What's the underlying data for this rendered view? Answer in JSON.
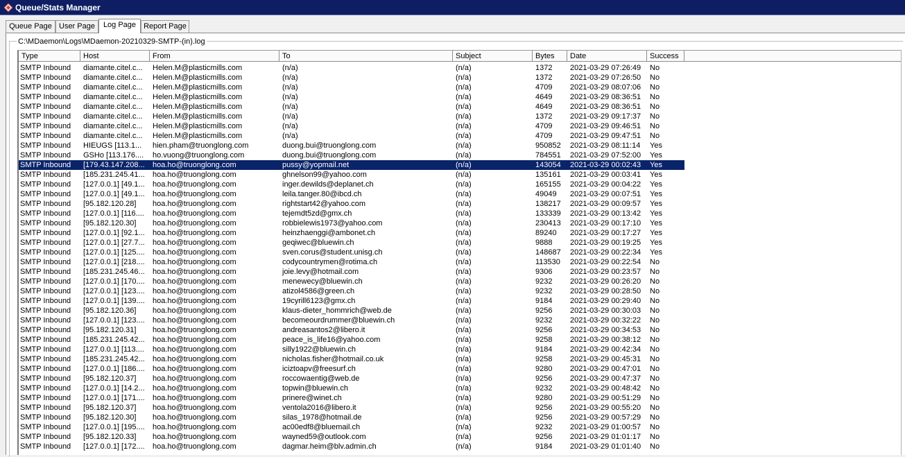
{
  "window": {
    "title": "Queue/Stats Manager"
  },
  "tabs": [
    {
      "label": "Queue Page",
      "active": false
    },
    {
      "label": "User Page",
      "active": false
    },
    {
      "label": "Log Page",
      "active": true
    },
    {
      "label": "Report Page",
      "active": false
    }
  ],
  "log_path": "C:\\MDaemon\\Logs\\MDaemon-20210329-SMTP-(in).log",
  "columns": [
    "Type",
    "Host",
    "From",
    "To",
    "Subject",
    "Bytes",
    "Date",
    "Success"
  ],
  "selected_row_index": 10,
  "rows": [
    [
      "SMTP Inbound",
      "diamante.citel.c...",
      "Helen.M@plasticmills.com",
      "(n/a)",
      "(n/a)",
      "1372",
      "2021-03-29 07:26:49",
      "No"
    ],
    [
      "SMTP Inbound",
      "diamante.citel.c...",
      "Helen.M@plasticmills.com",
      "(n/a)",
      "(n/a)",
      "1372",
      "2021-03-29 07:26:50",
      "No"
    ],
    [
      "SMTP Inbound",
      "diamante.citel.c...",
      "Helen.M@plasticmills.com",
      "(n/a)",
      "(n/a)",
      "4709",
      "2021-03-29 08:07:06",
      "No"
    ],
    [
      "SMTP Inbound",
      "diamante.citel.c...",
      "Helen.M@plasticmills.com",
      "(n/a)",
      "(n/a)",
      "4649",
      "2021-03-29 08:36:51",
      "No"
    ],
    [
      "SMTP Inbound",
      "diamante.citel.c...",
      "Helen.M@plasticmills.com",
      "(n/a)",
      "(n/a)",
      "4649",
      "2021-03-29 08:36:51",
      "No"
    ],
    [
      "SMTP Inbound",
      "diamante.citel.c...",
      "Helen.M@plasticmills.com",
      "(n/a)",
      "(n/a)",
      "1372",
      "2021-03-29 09:17:37",
      "No"
    ],
    [
      "SMTP Inbound",
      "diamante.citel.c...",
      "Helen.M@plasticmills.com",
      "(n/a)",
      "(n/a)",
      "4709",
      "2021-03-29 09:46:51",
      "No"
    ],
    [
      "SMTP Inbound",
      "diamante.citel.c...",
      "Helen.M@plasticmills.com",
      "(n/a)",
      "(n/a)",
      "4709",
      "2021-03-29 09:47:51",
      "No"
    ],
    [
      "SMTP Inbound",
      "HIEUGS [113.1...",
      "hien.pham@truonglong.com",
      "duong.bui@truonglong.com",
      "(n/a)",
      "950852",
      "2021-03-29 08:11:14",
      "Yes"
    ],
    [
      "SMTP Inbound",
      "GSHo [113.176....",
      "ho.vuong@truonglong.com",
      "duong.bui@truonglong.com",
      "(n/a)",
      "784551",
      "2021-03-29 07:52:00",
      "Yes"
    ],
    [
      "SMTP Inbound",
      "[179.43.147.208...",
      "hoa.ho@truonglong.com",
      "pussy@yopmail.net",
      "(n/a)",
      "143054",
      "2021-03-29 00:02:43",
      "Yes"
    ],
    [
      "SMTP Inbound",
      "[185.231.245.41...",
      "hoa.ho@truonglong.com",
      "ghnelson99@yahoo.com",
      "(n/a)",
      "135161",
      "2021-03-29 00:03:41",
      "Yes"
    ],
    [
      "SMTP Inbound",
      "[127.0.0.1] [49.1...",
      "hoa.ho@truonglong.com",
      "inger.dewilds@deplanet.ch",
      "(n/a)",
      "165155",
      "2021-03-29 00:04:22",
      "Yes"
    ],
    [
      "SMTP Inbound",
      "[127.0.0.1] [49.1...",
      "hoa.ho@truonglong.com",
      "leila.tanger.80@ibcd.ch",
      "(n/a)",
      "49049",
      "2021-03-29 00:07:51",
      "Yes"
    ],
    [
      "SMTP Inbound",
      "[95.182.120.28]",
      "hoa.ho@truonglong.com",
      "rightstart42@yahoo.com",
      "(n/a)",
      "138217",
      "2021-03-29 00:09:57",
      "Yes"
    ],
    [
      "SMTP Inbound",
      "[127.0.0.1] [116....",
      "hoa.ho@truonglong.com",
      "tejemdt5zd@gmx.ch",
      "(n/a)",
      "133339",
      "2021-03-29 00:13:42",
      "Yes"
    ],
    [
      "SMTP Inbound",
      "[95.182.120.30]",
      "hoa.ho@truonglong.com",
      "robbielewis1973@yahoo.com",
      "(n/a)",
      "230413",
      "2021-03-29 00:17:10",
      "Yes"
    ],
    [
      "SMTP Inbound",
      "[127.0.0.1] [92.1...",
      "hoa.ho@truonglong.com",
      "heinzhaenggi@ambonet.ch",
      "(n/a)",
      "89240",
      "2021-03-29 00:17:27",
      "Yes"
    ],
    [
      "SMTP Inbound",
      "[127.0.0.1] [27.7...",
      "hoa.ho@truonglong.com",
      "geqiwec@bluewin.ch",
      "(n/a)",
      "9888",
      "2021-03-29 00:19:25",
      "Yes"
    ],
    [
      "SMTP Inbound",
      "[127.0.0.1] [125....",
      "hoa.ho@truonglong.com",
      "sven.corus@student.unisg.ch",
      "(n/a)",
      "148687",
      "2021-03-29 00:22:34",
      "Yes"
    ],
    [
      "SMTP Inbound",
      "[127.0.0.1] [218....",
      "hoa.ho@truonglong.com",
      "codycountrymen@rotima.ch",
      "(n/a)",
      "113530",
      "2021-03-29 00:22:54",
      "No"
    ],
    [
      "SMTP Inbound",
      "[185.231.245.46...",
      "hoa.ho@truonglong.com",
      "joie.levy@hotmail.com",
      "(n/a)",
      "9306",
      "2021-03-29 00:23:57",
      "No"
    ],
    [
      "SMTP Inbound",
      "[127.0.0.1] [170....",
      "hoa.ho@truonglong.com",
      "menewecy@bluewin.ch",
      "(n/a)",
      "9232",
      "2021-03-29 00:26:20",
      "No"
    ],
    [
      "SMTP Inbound",
      "[127.0.0.1] [123....",
      "hoa.ho@truonglong.com",
      "atizol4586@green.ch",
      "(n/a)",
      "9232",
      "2021-03-29 00:28:50",
      "No"
    ],
    [
      "SMTP Inbound",
      "[127.0.0.1] [139....",
      "hoa.ho@truonglong.com",
      "19cyrill6123@gmx.ch",
      "(n/a)",
      "9184",
      "2021-03-29 00:29:40",
      "No"
    ],
    [
      "SMTP Inbound",
      "[95.182.120.36]",
      "hoa.ho@truonglong.com",
      "klaus-dieter_hommrich@web.de",
      "(n/a)",
      "9256",
      "2021-03-29 00:30:03",
      "No"
    ],
    [
      "SMTP Inbound",
      "[127.0.0.1] [123....",
      "hoa.ho@truonglong.com",
      "becomeourdrummer@bluewin.ch",
      "(n/a)",
      "9232",
      "2021-03-29 00:32:22",
      "No"
    ],
    [
      "SMTP Inbound",
      "[95.182.120.31]",
      "hoa.ho@truonglong.com",
      "andreasantos2@libero.it",
      "(n/a)",
      "9256",
      "2021-03-29 00:34:53",
      "No"
    ],
    [
      "SMTP Inbound",
      "[185.231.245.42...",
      "hoa.ho@truonglong.com",
      "peace_is_life16@yahoo.com",
      "(n/a)",
      "9258",
      "2021-03-29 00:38:12",
      "No"
    ],
    [
      "SMTP Inbound",
      "[127.0.0.1] [113....",
      "hoa.ho@truonglong.com",
      "silly1922@bluewin.ch",
      "(n/a)",
      "9184",
      "2021-03-29 00:42:34",
      "No"
    ],
    [
      "SMTP Inbound",
      "[185.231.245.42...",
      "hoa.ho@truonglong.com",
      "nicholas.fisher@hotmail.co.uk",
      "(n/a)",
      "9258",
      "2021-03-29 00:45:31",
      "No"
    ],
    [
      "SMTP Inbound",
      "[127.0.0.1] [186....",
      "hoa.ho@truonglong.com",
      "iciztoapv@freesurf.ch",
      "(n/a)",
      "9280",
      "2021-03-29 00:47:01",
      "No"
    ],
    [
      "SMTP Inbound",
      "[95.182.120.37]",
      "hoa.ho@truonglong.com",
      "roccowaentig@web.de",
      "(n/a)",
      "9256",
      "2021-03-29 00:47:37",
      "No"
    ],
    [
      "SMTP Inbound",
      "[127.0.0.1] [14.2...",
      "hoa.ho@truonglong.com",
      "topwin@bluewin.ch",
      "(n/a)",
      "9232",
      "2021-03-29 00:48:42",
      "No"
    ],
    [
      "SMTP Inbound",
      "[127.0.0.1] [171....",
      "hoa.ho@truonglong.com",
      "prinere@winet.ch",
      "(n/a)",
      "9280",
      "2021-03-29 00:51:29",
      "No"
    ],
    [
      "SMTP Inbound",
      "[95.182.120.37]",
      "hoa.ho@truonglong.com",
      "ventola2016@libero.it",
      "(n/a)",
      "9256",
      "2021-03-29 00:55:20",
      "No"
    ],
    [
      "SMTP Inbound",
      "[95.182.120.30]",
      "hoa.ho@truonglong.com",
      "silas_1978@hotmail.de",
      "(n/a)",
      "9256",
      "2021-03-29 00:57:29",
      "No"
    ],
    [
      "SMTP Inbound",
      "[127.0.0.1] [195....",
      "hoa.ho@truonglong.com",
      "ac00edf8@bluemail.ch",
      "(n/a)",
      "9232",
      "2021-03-29 01:00:57",
      "No"
    ],
    [
      "SMTP Inbound",
      "[95.182.120.33]",
      "hoa.ho@truonglong.com",
      "wayned59@outlook.com",
      "(n/a)",
      "9256",
      "2021-03-29 01:01:17",
      "No"
    ],
    [
      "SMTP Inbound",
      "[127.0.0.1] [172....",
      "hoa.ho@truonglong.com",
      "dagmar.heim@blv.admin.ch",
      "(n/a)",
      "9184",
      "2021-03-29 01:01:40",
      "No"
    ]
  ]
}
